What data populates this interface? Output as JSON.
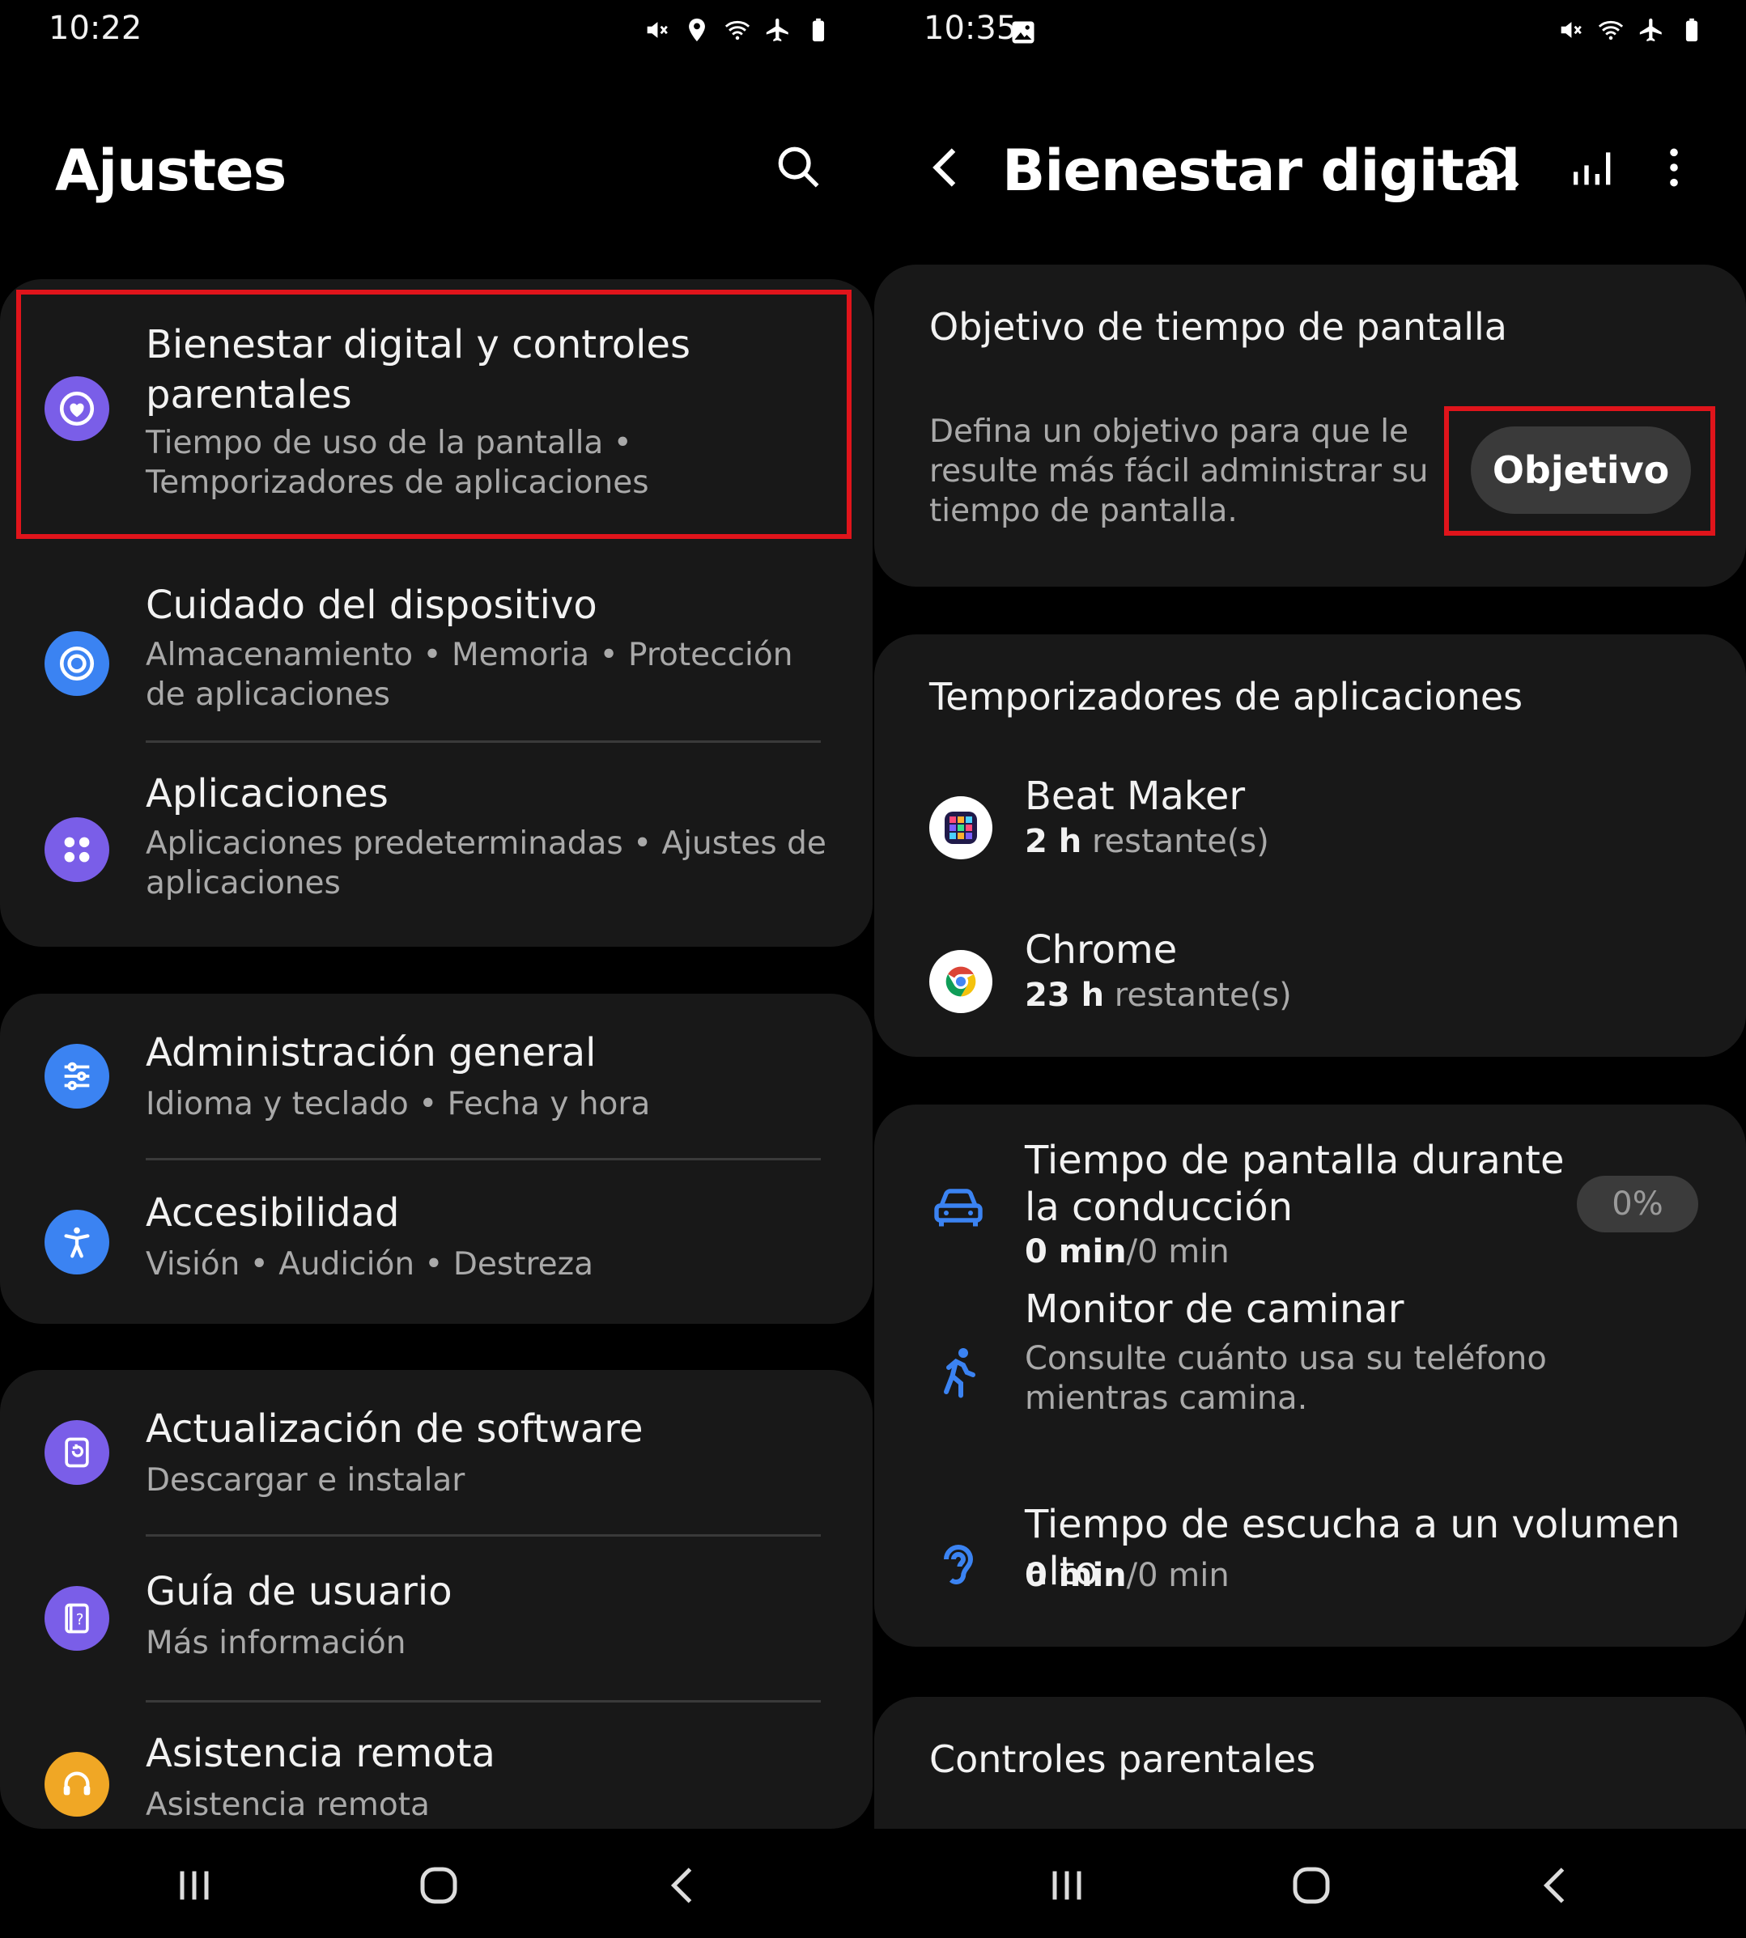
{
  "left": {
    "status_time": "10:22",
    "title": "Ajustes",
    "items": [
      {
        "title": "Bienestar digital y controles parentales",
        "sub": "Tiempo de uso de la pantalla  •  Temporizadores de aplicaciones",
        "icon": "digital-wellbeing-icon",
        "color": "#7a5ee8"
      },
      {
        "title": "Cuidado del dispositivo",
        "sub": "Almacenamiento  •  Memoria  •  Protección de aplicaciones",
        "icon": "device-care-icon",
        "color": "#3b83f2"
      },
      {
        "title": "Aplicaciones",
        "sub": "Aplicaciones predeterminadas  •  Ajustes de aplicaciones",
        "icon": "apps-icon",
        "color": "#7a5ee8"
      },
      {
        "title": "Administración general",
        "sub": "Idioma y teclado  •  Fecha y hora",
        "icon": "general-management-icon",
        "color": "#3b83f2"
      },
      {
        "title": "Accesibilidad",
        "sub": "Visión  •  Audición  •  Destreza",
        "icon": "accessibility-icon",
        "color": "#3b83f2"
      },
      {
        "title": "Actualización de software",
        "sub": "Descargar e instalar",
        "icon": "software-update-icon",
        "color": "#7a5ee8"
      },
      {
        "title": "Guía de usuario",
        "sub": "Más información",
        "icon": "user-guide-icon",
        "color": "#7a5ee8"
      },
      {
        "title": "Asistencia remota",
        "sub": "Asistencia remota",
        "icon": "remote-support-icon",
        "color": "#f0a725"
      }
    ]
  },
  "right": {
    "status_time": "10:35",
    "title": "Bienestar digital",
    "goal": {
      "title": "Objetivo de tiempo de pantalla",
      "desc": "Defina un objetivo para que le resulte más fácil administrar su tiempo de pantalla.",
      "button": "Objetivo"
    },
    "timers": {
      "title": "Temporizadores de aplicaciones",
      "apps": [
        {
          "name": "Beat Maker",
          "amount": "2 h",
          "rest": " restante(s)"
        },
        {
          "name": "Chrome",
          "amount": "23 h",
          "rest": " restante(s)"
        }
      ]
    },
    "wellbeing": {
      "driving": {
        "title": "Tiempo de pantalla durante la conducción",
        "value": "0 min",
        "rest": "/0 min",
        "pct": "0%"
      },
      "walking": {
        "title": "Monitor de caminar",
        "sub": "Consulte cuánto usa su teléfono mientras camina."
      },
      "volume": {
        "title": "Tiempo de escucha a un volumen alto",
        "value": "0 min",
        "rest": "/0 min"
      }
    },
    "parental": {
      "title": "Controles parentales"
    }
  },
  "colors": {
    "highlight": "#e0141b",
    "accent_blue": "#3b83f2",
    "accent_purple": "#7a5ee8"
  }
}
